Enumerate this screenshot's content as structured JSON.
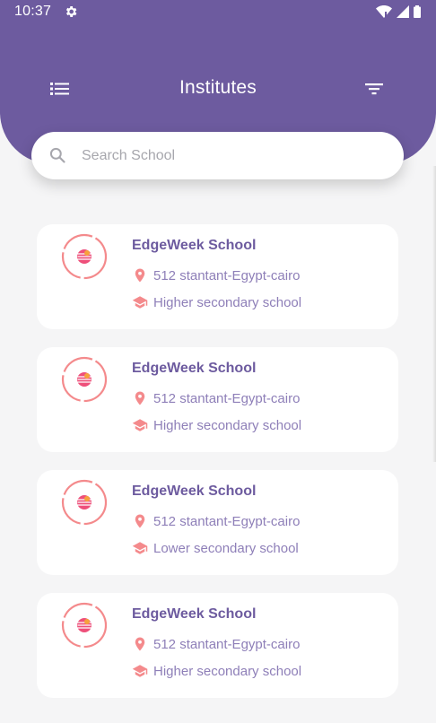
{
  "status_bar": {
    "time": "10:37",
    "icons": [
      "gear-icon",
      "wifi-icon",
      "signal-icon",
      "battery-icon"
    ]
  },
  "app_bar": {
    "title": "Institutes",
    "left_icon": "list-menu-icon",
    "right_icon": "filter-icon"
  },
  "search": {
    "placeholder": "Search School",
    "value": ""
  },
  "colors": {
    "primary": "#6d5b9f",
    "accent": "#f48a8c",
    "secondary_text": "#8e7fb8",
    "background": "#f5f5f6"
  },
  "schools": [
    {
      "name": "EdgeWeek School",
      "address": "512 stantant-Egypt-cairo",
      "type": "Higher secondary school"
    },
    {
      "name": "EdgeWeek School",
      "address": "512 stantant-Egypt-cairo",
      "type": "Higher secondary school"
    },
    {
      "name": "EdgeWeek School",
      "address": "512 stantant-Egypt-cairo",
      "type": "Lower secondary school"
    },
    {
      "name": "EdgeWeek School",
      "address": "512 stantant-Egypt-cairo",
      "type": "Higher secondary school"
    }
  ]
}
